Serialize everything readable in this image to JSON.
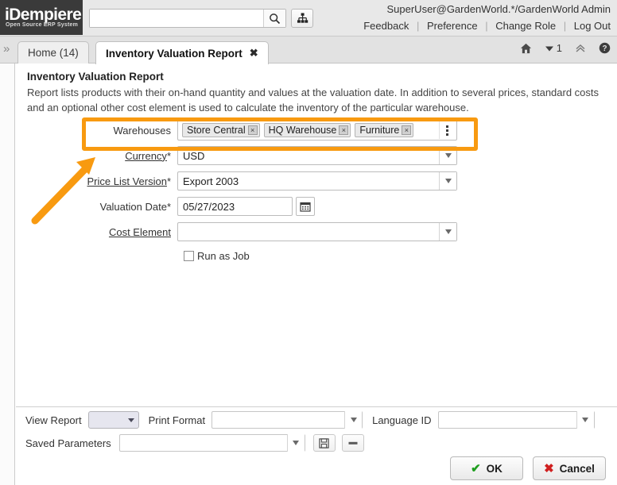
{
  "header": {
    "logo_main": "iDempiere",
    "logo_sub": "Open Source  ERP System",
    "search_placeholder": "",
    "search_value": "",
    "search_icon": "search-icon",
    "tree_icon": "sitemap-icon",
    "user_info": "SuperUser@GardenWorld.*/GardenWorld Admin",
    "links": [
      {
        "label": "Feedback"
      },
      {
        "label": "Preference"
      },
      {
        "label": "Change Role"
      },
      {
        "label": "Log Out"
      }
    ],
    "separator": "|"
  },
  "tabbar": {
    "collapse_icon": "»",
    "tabs": [
      {
        "label": "Home (14)",
        "active": false,
        "closable": false
      },
      {
        "label": "Inventory Valuation Report",
        "active": true,
        "closable": true,
        "close_icon": "✖"
      }
    ],
    "icons": [
      {
        "name": "home-icon"
      },
      {
        "name": "window-count-icon",
        "count": "1"
      },
      {
        "name": "collapse-up-icon"
      },
      {
        "name": "help-icon"
      }
    ]
  },
  "panel": {
    "title": "Inventory Valuation Report",
    "description": "Report lists products with their on-hand quantity and values at the valuation date. In addition to several prices, standard costs and an optional other cost element is used to calculate the inventory of the particular warehouse."
  },
  "form": {
    "warehouses": {
      "label": "Warehouses",
      "required": false,
      "is_link": false,
      "chips": [
        {
          "label": "Store Central",
          "remove_icon": "×"
        },
        {
          "label": "HQ Warehouse",
          "remove_icon": "×"
        },
        {
          "label": "Furniture",
          "remove_icon": "×"
        }
      ],
      "menu_icon": "kebab-menu-icon"
    },
    "currency": {
      "label": "Currency",
      "required": true,
      "is_link": true,
      "value": "USD",
      "dropdown_icon": "chevron-down-icon"
    },
    "price_list_version": {
      "label": "Price List Version",
      "required": true,
      "is_link": true,
      "value": "Export 2003",
      "dropdown_icon": "chevron-down-icon"
    },
    "valuation_date": {
      "label": "Valuation Date",
      "required": true,
      "is_link": false,
      "value": "05/27/2023",
      "calendar_icon": "calendar-icon"
    },
    "cost_element": {
      "label": "Cost Element",
      "required": false,
      "is_link": true,
      "value": "",
      "dropdown_icon": "chevron-down-icon"
    },
    "run_as_job": {
      "label": "Run as Job",
      "checked": false
    }
  },
  "bottom": {
    "view_report": {
      "label": "View Report",
      "value": ""
    },
    "print_format": {
      "label": "Print Format",
      "value": ""
    },
    "language_id": {
      "label": "Language ID",
      "value": ""
    },
    "saved_parameters": {
      "label": "Saved Parameters",
      "value": ""
    },
    "save_icon": "floppy-save-icon",
    "delete_icon": "minus-delete-icon",
    "ok_button": {
      "label": "OK",
      "icon": "✔"
    },
    "cancel_button": {
      "label": "Cancel",
      "icon": "✖"
    }
  },
  "annotation": {
    "highlight_color": "#f89a10",
    "arrow_color": "#f89a10",
    "target": "warehouses-field"
  }
}
